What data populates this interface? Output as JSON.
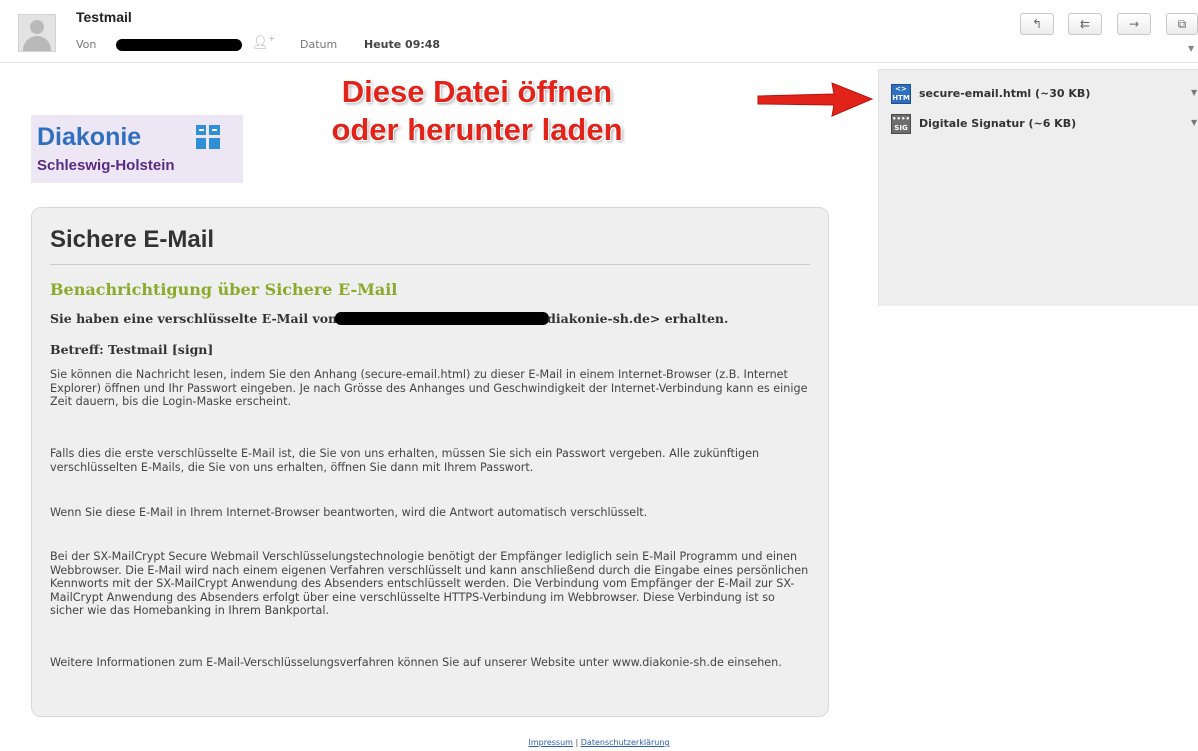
{
  "header": {
    "subject": "Testmail",
    "from_label": "Von",
    "date_label": "Datum",
    "date_value": "Heute 09:48"
  },
  "toolbar": {
    "buttons": [
      {
        "name": "reply",
        "glyph": "↰"
      },
      {
        "name": "reply-all",
        "glyph": "⇇"
      },
      {
        "name": "forward",
        "glyph": "→"
      },
      {
        "name": "open-window",
        "glyph": "⧉"
      }
    ]
  },
  "attachments": [
    {
      "name": "secure-email.html (~30 KB)",
      "icon": "HTM",
      "icon_name": "html-file-icon"
    },
    {
      "name": "Digitale Signatur (~6 KB)",
      "icon": "SIG",
      "icon_name": "signature-file-icon"
    }
  ],
  "annotation": {
    "line1": "Diese Datei öffnen",
    "line2": "oder herunter laden",
    "color": "#e2231a"
  },
  "logo": {
    "name": "Diakonie",
    "subtitle": "Schleswig-Holstein"
  },
  "message": {
    "title": "Sichere E-Mail",
    "subtitle": "Benachrichtigung über Sichere E-Mail",
    "intro_prefix": "Sie haben eine verschlüsselte E-Mail von",
    "intro_suffix": "diakonie-sh.de> erhalten.",
    "betreff": "Betreff: Testmail [sign]",
    "paragraphs": [
      "Sie können die Nachricht lesen, indem Sie den Anhang (secure-email.html) zu dieser E-Mail in einem Internet-Browser (z.B. Internet Explorer) öffnen und Ihr Passwort eingeben. Je nach Grösse des Anhanges und Geschwindigkeit der Internet-Verbindung kann es einige Zeit dauern, bis die Login-Maske erscheint.",
      "Falls dies die erste verschlüsselte E-Mail ist, die Sie von uns erhalten, müssen Sie sich ein Passwort vergeben. Alle zukünftigen verschlüsselten E-Mails, die Sie von uns erhalten, öffnen Sie dann mit Ihrem Passwort.",
      "Wenn Sie diese E-Mail in Ihrem Internet-Browser beantworten, wird die Antwort automatisch verschlüsselt.",
      "Bei der SX-MailCrypt Secure Webmail Verschlüsselungstechnologie benötigt der Empfänger lediglich sein E-Mail Programm und einen Webbrowser. Die E-Mail wird nach einem eigenen Verfahren verschlüsselt und kann anschließend durch die Eingabe eines persönlichen Kennworts mit der SX-MailCrypt Anwendung des Absenders entschlüsselt werden. Die Verbindung vom Empfänger der E-Mail zur SX-MailCrypt Anwendung des Absenders erfolgt über eine verschlüsselte HTTPS-Verbindung im Webbrowser. Diese Verbindung ist so sicher wie das Homebanking in Ihrem Bankportal.",
      "Weitere Informationen zum E-Mail-Verschlüsselungsverfahren können Sie auf unserer Website unter www.diakonie-sh.de einsehen."
    ]
  },
  "footer": {
    "impressum": "Impressum",
    "separator": "|",
    "datenschutz": "Datenschutzerklärung"
  }
}
